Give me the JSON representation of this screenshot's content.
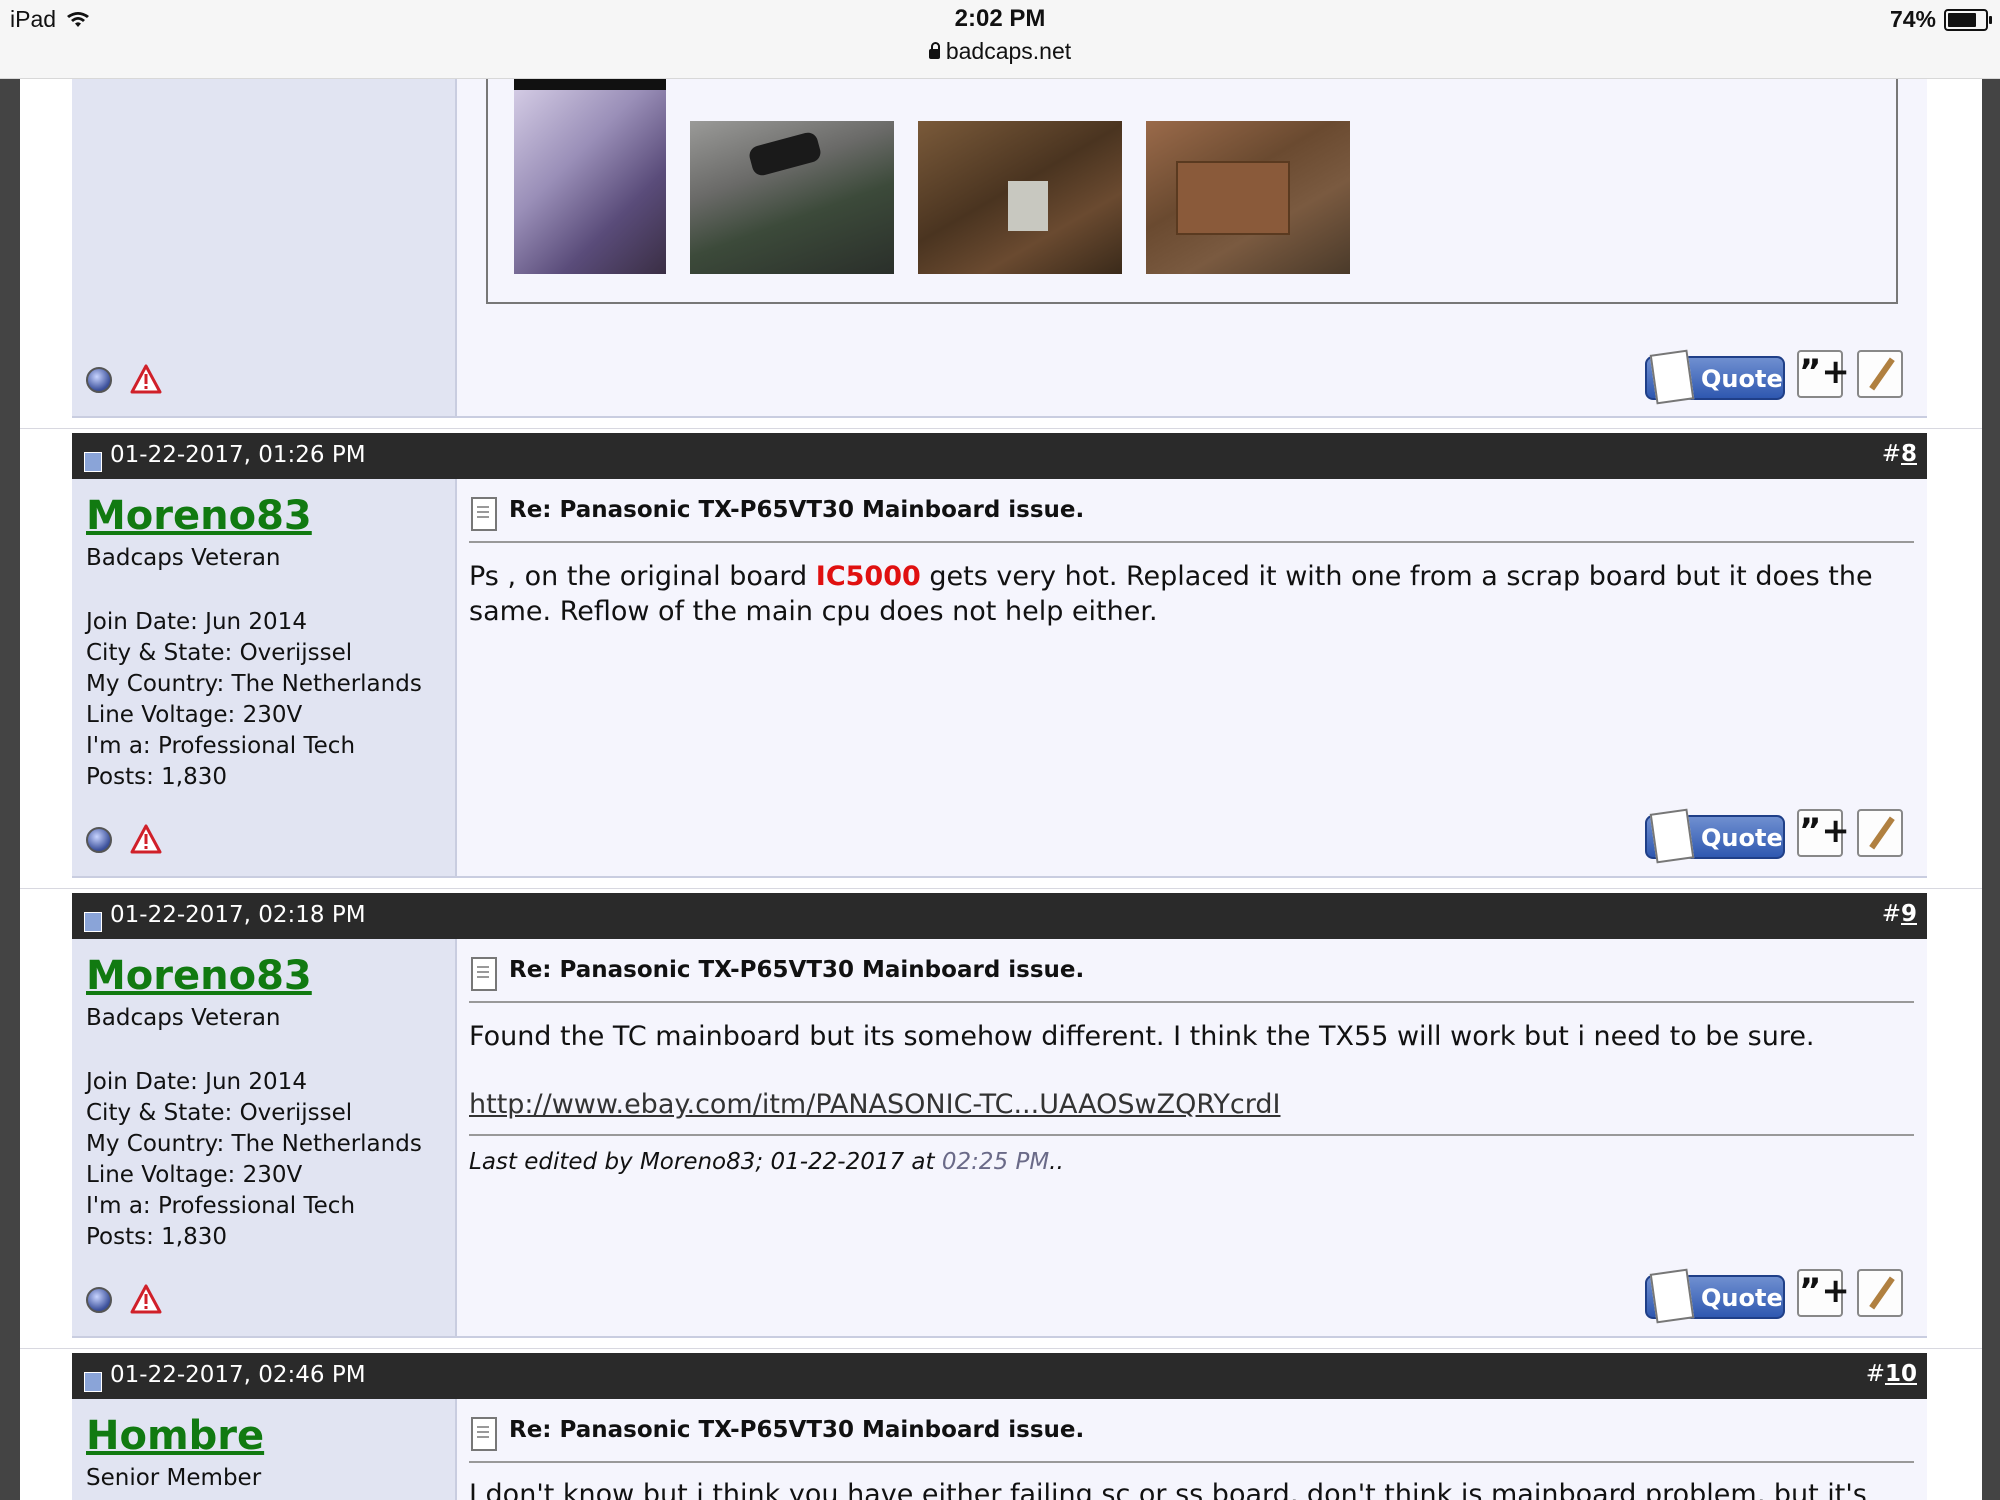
{
  "status_bar": {
    "device": "iPad",
    "time": "2:02 PM",
    "url": "badcaps.net",
    "battery": "74%"
  },
  "icons": {
    "wifi": "wifi-icon",
    "lock": "lock-icon",
    "battery": "battery-icon",
    "online": "online-status-icon",
    "report": "report-warning-icon",
    "post_doc": "post-document-icon",
    "multiquote": "multiquote-icon",
    "edit": "edit-post-icon"
  },
  "buttons": {
    "quote": "Quote",
    "multiquote": "”+"
  },
  "posts": [
    {
      "date": "01-22-2017, 01:26 PM",
      "number_prefix": "#",
      "number": "8",
      "username": "Moreno83",
      "usertitle": "Badcaps Veteran",
      "info": [
        "Join Date: Jun 2014",
        "City & State: Overijssel",
        "My Country: The Netherlands",
        "Line Voltage: 230V",
        "I'm a: Professional Tech",
        "Posts: 1,830"
      ],
      "title": "Re: Panasonic TX-P65VT30 Mainboard issue.",
      "text_before": "Ps , on the original board ",
      "highlight": "IC5000",
      "text_after": " gets very hot. Replaced it with one from a scrap board but it does the same. Reflow of the main cpu does not help either."
    },
    {
      "date": "01-22-2017, 02:18 PM",
      "number_prefix": "#",
      "number": "9",
      "username": "Moreno83",
      "usertitle": "Badcaps Veteran",
      "info": [
        "Join Date: Jun 2014",
        "City & State: Overijssel",
        "My Country: The Netherlands",
        "Line Voltage: 230V",
        "I'm a: Professional Tech",
        "Posts: 1,830"
      ],
      "title": "Re: Panasonic TX-P65VT30 Mainboard issue.",
      "text": "Found the TC mainboard but its somehow different. I think the TX55 will work but i need to be sure.",
      "link": "http://www.ebay.com/itm/PANASONIC-TC...UAAOSwZQRYcrdI",
      "edit_note_prefix": "Last edited by Moreno83; 01-22-2017 at ",
      "edit_time": "02:25 PM",
      "edit_note_suffix": ".."
    },
    {
      "date": "01-22-2017, 02:46 PM",
      "number_prefix": "#",
      "number": "10",
      "username": "Hombre",
      "usertitle": "Senior Member",
      "title": "Re: Panasonic TX-P65VT30 Mainboard issue.",
      "text": "I don't know but i think you have either failing sc or ss board, don't think is mainboard problem, but it's"
    }
  ]
}
